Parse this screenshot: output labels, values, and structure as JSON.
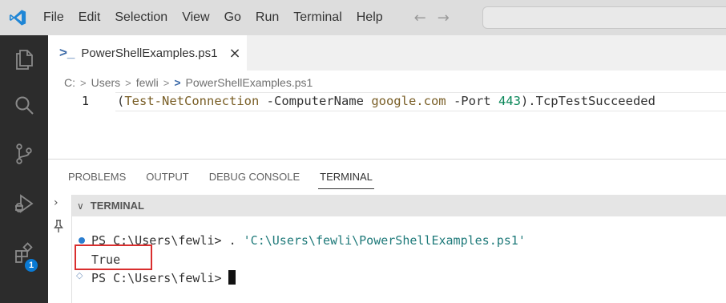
{
  "menu": [
    "File",
    "Edit",
    "Selection",
    "View",
    "Go",
    "Run",
    "Terminal",
    "Help"
  ],
  "nav": {
    "back_icon": "arrow-left-icon",
    "forward_icon": "arrow-right-icon"
  },
  "activity_bar": {
    "items": [
      "explorer-icon",
      "search-icon",
      "source-control-icon",
      "run-debug-icon",
      "extensions-icon"
    ],
    "extensions_badge": "1"
  },
  "editor": {
    "tab": {
      "label": "PowerShellExamples.ps1",
      "close": "×"
    },
    "breadcrumb": [
      "C:",
      "Users",
      "fewli",
      "PowerShellExamples.ps1"
    ],
    "line_number": "1",
    "code_tokens": [
      {
        "t": "(",
        "c": "c-punc"
      },
      {
        "t": "Test-NetConnection",
        "c": "c-cmd"
      },
      {
        "t": " -ComputerName ",
        "c": "c-param"
      },
      {
        "t": "google.com",
        "c": "c-str"
      },
      {
        "t": " -Port ",
        "c": "c-param"
      },
      {
        "t": "443",
        "c": "c-num"
      },
      {
        "t": ").TcpTestSucceeded",
        "c": "c-punc"
      }
    ]
  },
  "panel": {
    "tabs": [
      "PROBLEMS",
      "OUTPUT",
      "DEBUG CONSOLE",
      "TERMINAL"
    ],
    "active_tab": "TERMINAL",
    "section_title": "TERMINAL",
    "terminal": {
      "line1_prompt": "PS C:\\Users\\fewli> . ",
      "line1_arg": "'C:\\Users\\fewli\\PowerShellExamples.ps1'",
      "line2_output": "True",
      "line3_prompt": "PS C:\\Users\\fewli>"
    }
  },
  "colors": {
    "accent": "#0a7ad4",
    "activity_bar": "#2c2c2c",
    "highlight": "#d92e2e"
  }
}
